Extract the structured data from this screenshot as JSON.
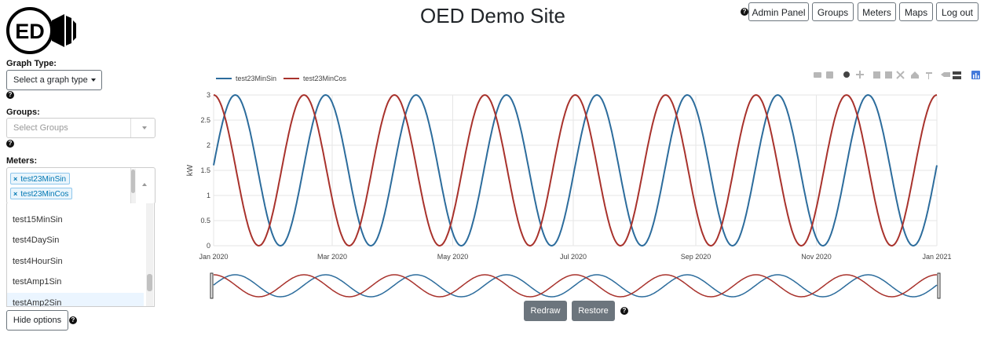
{
  "header": {
    "logo_text": "ED",
    "title": "OED Demo Site",
    "nav": [
      "Admin Panel",
      "Groups",
      "Meters",
      "Maps",
      "Log out"
    ]
  },
  "sidebar": {
    "graph_type_label": "Graph Type:",
    "graph_type_select": "Select a graph type",
    "groups_label": "Groups:",
    "groups_placeholder": "Select Groups",
    "meters_label": "Meters:",
    "selected_meters": [
      "test23MinSin",
      "test23MinCos"
    ],
    "meter_options": [
      "test15MinSin",
      "test4DaySin",
      "test4HourSin",
      "testAmp1Sin",
      "testAmp2Sin"
    ],
    "hide_options": "Hide options"
  },
  "buttons": {
    "redraw": "Redraw",
    "restore": "Restore"
  },
  "colors": {
    "sin": "#2c6c9c",
    "cos": "#a8322c",
    "tag_text": "#0077b3",
    "gray_button": "#6c757d"
  },
  "toolbar_icons": [
    "camera-icon",
    "save-icon",
    "zoom-icon",
    "pan-icon",
    "zoom-in-icon",
    "zoom-out-icon",
    "autoscale-icon",
    "reset-axes-icon",
    "spike-lines-icon",
    "hover-closest-icon",
    "hover-compare-icon",
    "plotly-logo-icon"
  ],
  "chart_data": {
    "type": "line",
    "ylabel": "kW",
    "ylim": [
      0,
      3
    ],
    "yticks": [
      "0",
      "0.5",
      "1",
      "1.5",
      "2",
      "2.5",
      "3"
    ],
    "xlim": [
      "2020-01-01",
      "2021-01-01"
    ],
    "xticks": [
      "Jan 2020",
      "Mar 2020",
      "May 2020",
      "Jul 2020",
      "Sep 2020",
      "Nov 2020",
      "Jan 2021"
    ],
    "legend_placement": "top-left",
    "grid": true,
    "range_slider": true,
    "series": [
      {
        "name": "test23MinSin",
        "function": "sine",
        "min": 0,
        "max": 3,
        "period_days": 45.75,
        "start_value": 1.6,
        "color": "#2c6c9c"
      },
      {
        "name": "test23MinCos",
        "function": "cosine",
        "min": 0,
        "max": 3,
        "period_days": 45.75,
        "start_value": 3.0,
        "color": "#a8322c"
      }
    ]
  }
}
